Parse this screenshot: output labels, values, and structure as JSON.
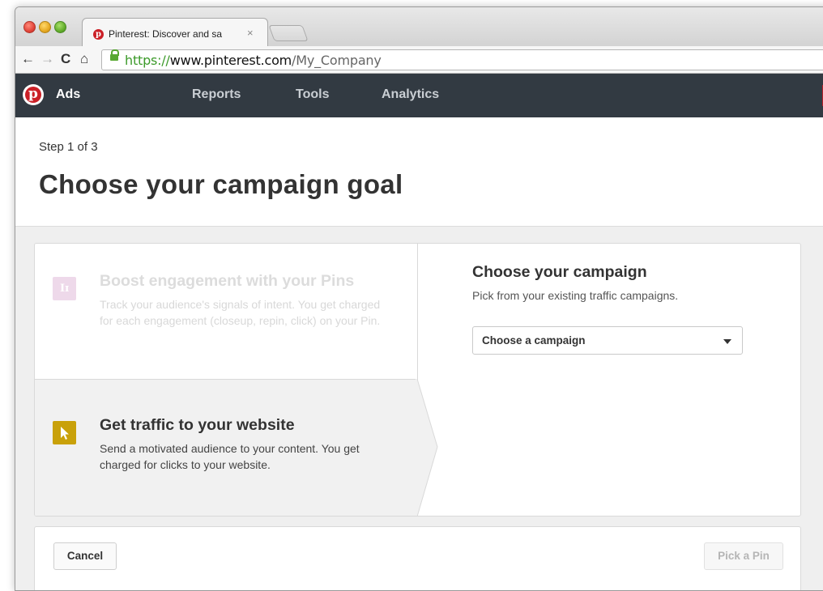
{
  "browser": {
    "tab_title": "Pinterest: Discover and sa",
    "tab_close": "×",
    "url_scheme": "https://",
    "url_host": "www.pinterest.com",
    "url_path": "/My_Company"
  },
  "nav": {
    "logo_glyph": "p",
    "ads_label": "Ads",
    "links": [
      "Reports",
      "Tools",
      "Analytics"
    ]
  },
  "header": {
    "step": "Step 1 of 3",
    "title": "Choose your campaign goal"
  },
  "goals": [
    {
      "icon": "engagement-icon",
      "title": "Boost engagement with your Pins",
      "description": "Track your audience's signals of intent. You get charged for each engagement (closeup, repin, click) on your Pin.",
      "selected": false
    },
    {
      "icon": "cursor-icon",
      "title": "Get traffic to your website",
      "description": "Send a motivated audience to your content. You get charged for clicks to your website.",
      "selected": true
    }
  ],
  "campaign": {
    "title": "Choose your campaign",
    "subtitle": "Pick from your existing traffic campaigns.",
    "select_value": "Choose a campaign"
  },
  "footer": {
    "cancel_label": "Cancel",
    "next_label": "Pick a Pin"
  },
  "colors": {
    "nav_bg": "#323a42",
    "brand_red": "#cb2027",
    "traffic_icon": "#c9a10a",
    "engage_icon": "#eed9ea"
  }
}
